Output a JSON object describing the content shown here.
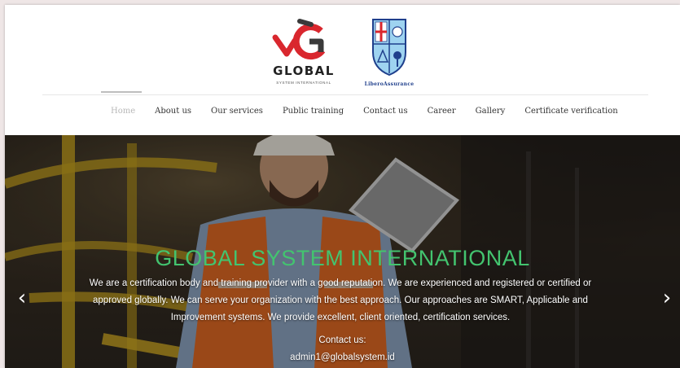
{
  "header": {
    "logo_global": {
      "name": "GLOBAL",
      "tagline": "SYSTEM INTERNATIONAL",
      "colors": {
        "red": "#d9272e",
        "dark": "#3a3a3a"
      }
    },
    "logo_libero": {
      "name": "LiberoAssurance",
      "colors": {
        "blue": "#1f3f8c",
        "shield": "#9ed3f0"
      }
    }
  },
  "nav": {
    "items": [
      {
        "label": "Home",
        "active": true
      },
      {
        "label": "About us"
      },
      {
        "label": "Our services"
      },
      {
        "label": "Public training"
      },
      {
        "label": "Contact us"
      },
      {
        "label": "Career"
      },
      {
        "label": "Gallery"
      },
      {
        "label": "Certificate verification"
      }
    ]
  },
  "hero": {
    "title": "GLOBAL SYSTEM INTERNATIONAL",
    "description": "We are a certification body and training provider with a good reputation. We are experienced and registered or certified or approved globally. We can serve your organization with the best approach. Our approaches are SMART, Applicable and Improvement systems. We provide excellent, client oriented, certification services.",
    "contact_label": "Contact us:",
    "contact_email": "admin1@globalsystem.id",
    "prev_icon": "chevron-left-icon",
    "next_icon": "chevron-right-icon",
    "title_color": "#43c46f"
  }
}
